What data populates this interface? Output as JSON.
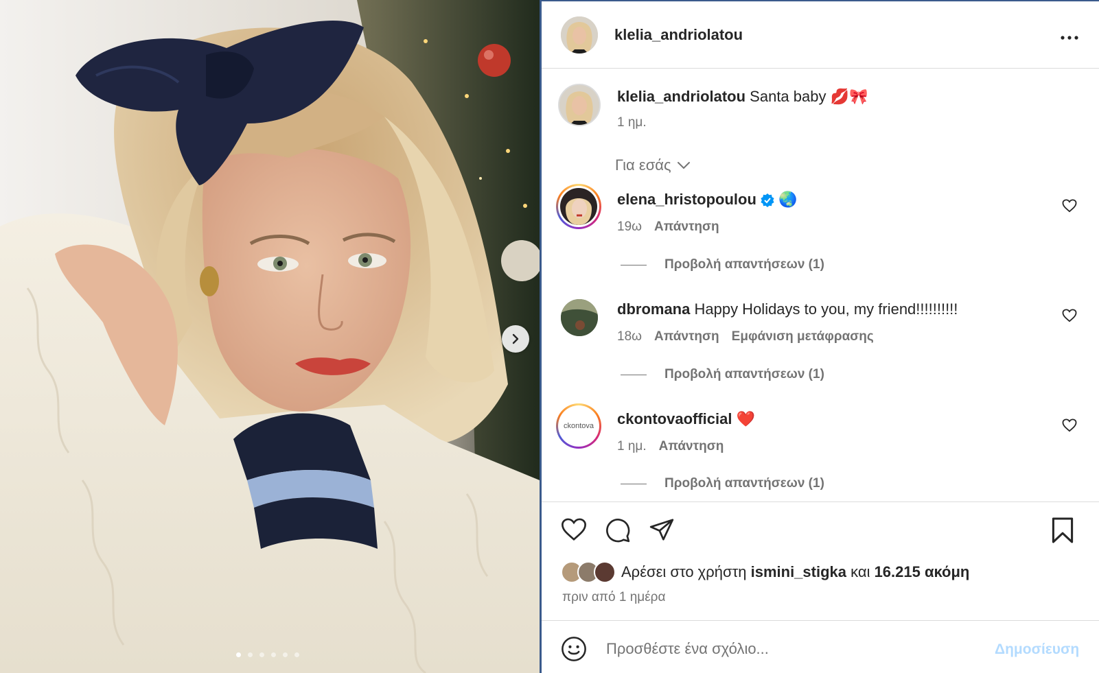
{
  "post": {
    "username": "klelia_andriolatou",
    "more_icon": "more-horizontal-icon",
    "photo": {
      "description_icon": "photo",
      "carousel_total": 6,
      "carousel_active_index": 0
    }
  },
  "caption": {
    "username": "klelia_andriolatou",
    "text": " Santa baby 💋🎀",
    "time": "1 ημ."
  },
  "filter_label": "Για εσάς",
  "comments": [
    {
      "username": "elena_hristopoulou",
      "text": " 🌏",
      "verified": true,
      "time": "19ω",
      "reply_label": "Απάντηση",
      "translate_label": "",
      "view_replies": "Προβολή απαντήσεων (1)"
    },
    {
      "username": "dbromana",
      "text": " Happy Holidays to you, my friend!!!!!!!!!!",
      "verified": false,
      "time": "18ω",
      "reply_label": "Απάντηση",
      "translate_label": "Εμφάνιση μετάφρασης",
      "view_replies": "Προβολή απαντήσεων (1)"
    },
    {
      "username": "ckontovaofficial",
      "text": " ❤️",
      "verified": false,
      "avatar_text": "ckontova",
      "time": "1 ημ.",
      "reply_label": "Απάντηση",
      "translate_label": "",
      "view_replies": "Προβολή απαντήσεων (1)"
    }
  ],
  "likes": {
    "prefix": "Αρέσει στο χρήστη ",
    "user": "ismini_stigka",
    "middle": " και ",
    "count": "16.215 ακόμη",
    "time_ago": "πριν από 1 ημέρα"
  },
  "composer": {
    "placeholder": "Προσθέστε ένα σχόλιο...",
    "post_label": "Δημοσίευση"
  },
  "colors": {
    "accent_blue": "#0095f6",
    "post_disabled": "#b3dbff",
    "secondary_text": "#737373",
    "heart_red": "#ed4956"
  }
}
